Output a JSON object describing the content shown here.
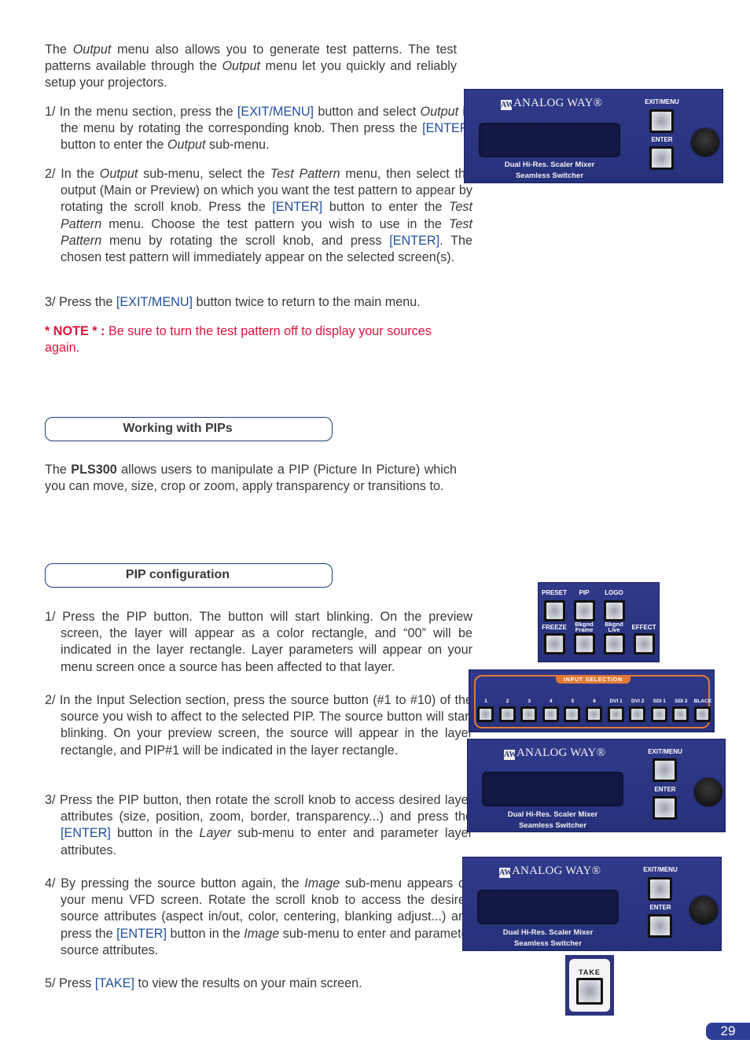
{
  "intro": {
    "p1": "The ",
    "p1_italic": "Output",
    "p2": " menu also allows you to generate test patterns. The test patterns available through the ",
    "p2_italic": "Output",
    "p3": " menu let you quickly and reliably setup your projectors."
  },
  "steps_output": [
    {
      "num": "1/ ",
      "t1": "In the menu section, press the ",
      "b1": "[EXIT/MENU]",
      "t2": " button and select ",
      "i1": "Output",
      "t3": " in the menu by rotating the corresponding knob. Then press the ",
      "b2": "[ENTER]",
      "t4": " button to enter the ",
      "i2": "Output",
      "t5": " sub-menu."
    },
    {
      "num": "2/ ",
      "t1": "In the ",
      "i1": "Output",
      "t2": " sub-menu, select the ",
      "i2": "Test Pattern",
      "t3": " menu, then select the output (Main or Preview) on which you want the test pattern to appear by rotating the scroll knob. Press the ",
      "b1": "[ENTER]",
      "t4": " button to enter the ",
      "i3": "Test Pattern",
      "t5": " menu. Choose the test pattern you wish to use in the ",
      "i4": "Test Pattern",
      "t6": " menu by rotating the scroll knob, and press ",
      "b2": "[ENTER]",
      "t7": ". The chosen test pattern will immediately appear on the selected screen(s)."
    },
    {
      "num": "3/ ",
      "t1": "Press the ",
      "b1": "[EXIT/MENU]",
      "t2": " button twice to return to the main menu."
    }
  ],
  "note": {
    "label": "* NOTE * : ",
    "text": "Be sure to turn the test pattern off to display your sources again."
  },
  "section_pips": {
    "heading": "Working with PIPs",
    "t1": "The ",
    "bold": "PLS300",
    "t2": " allows users to manipulate a PIP (Picture In Picture) which you can move, size, crop or zoom, apply transparency or transitions to."
  },
  "section_config": {
    "heading": "PIP configuration",
    "steps": [
      {
        "num": "1/ ",
        "text": "Press the PIP button. The button will start blinking. On the preview screen, the layer will appear as a color rectangle, and “00” will be indicated in the layer rectangle. Layer parameters will appear on your menu screen once a source has been affected to that layer."
      },
      {
        "num": "2/ ",
        "text": "In the Input Selection section, press the source button (#1 to #10) of the source you wish to affect to the selected PIP. The source button will start blinking. On your preview screen, the source will appear in the layer rectangle, and PIP#1 will be indicated in the layer rectangle."
      },
      {
        "num": "3/ ",
        "t1": "Press the PIP button, then rotate the scroll knob to access desired layer attributes (size, position, zoom, border, transparency...) and press the ",
        "b1": "[ENTER]",
        "t2": " button in the ",
        "i1": "Layer",
        "t3": " sub-menu to enter and parameter layer attributes."
      },
      {
        "num": "4/ ",
        "t1": "By pressing the source button again, the ",
        "i1": "Image",
        "t2": " sub-menu appears on your menu VFD screen. Rotate the scroll knob to access the desired source attributes (aspect in/out, color, centering, blanking adjust...) and press the ",
        "b1": "[ENTER]",
        "t3": " button in the ",
        "i2": "Image",
        "t4": " sub-menu to enter and parameter source attributes."
      },
      {
        "num": "5/ ",
        "t1": "Press ",
        "b1": "[TAKE]",
        "t2": " to view the results on your main screen."
      }
    ]
  },
  "panel": {
    "brand": "ANALOG WAY®",
    "brand_mark": "AW",
    "exit_menu": "EXIT/MENU",
    "enter": "ENTER",
    "sub1": "Dual Hi-Res. Scaler Mixer",
    "sub2": "Seamless Switcher"
  },
  "pip_panel": {
    "row1": [
      "PRESET",
      "PIP",
      "LOGO"
    ],
    "row2": [
      "FREEZE",
      "Bkgnd Frame",
      "Bkgnd Live",
      "EFFECT"
    ]
  },
  "input_selection": {
    "title": "INPUT SELECTION",
    "buttons": [
      "1",
      "2",
      "3",
      "4",
      "5",
      "6",
      "DVI 1",
      "DVI 2",
      "SDI 1",
      "SDI 2",
      "BLACK"
    ]
  },
  "take": {
    "label": "TAKE"
  },
  "page_number": "29",
  "colors": {
    "link_blue": "#1f4e9c",
    "note_red": "#e0143c",
    "panel_blue": "#2d3580",
    "accent_orange": "#e07a34"
  }
}
